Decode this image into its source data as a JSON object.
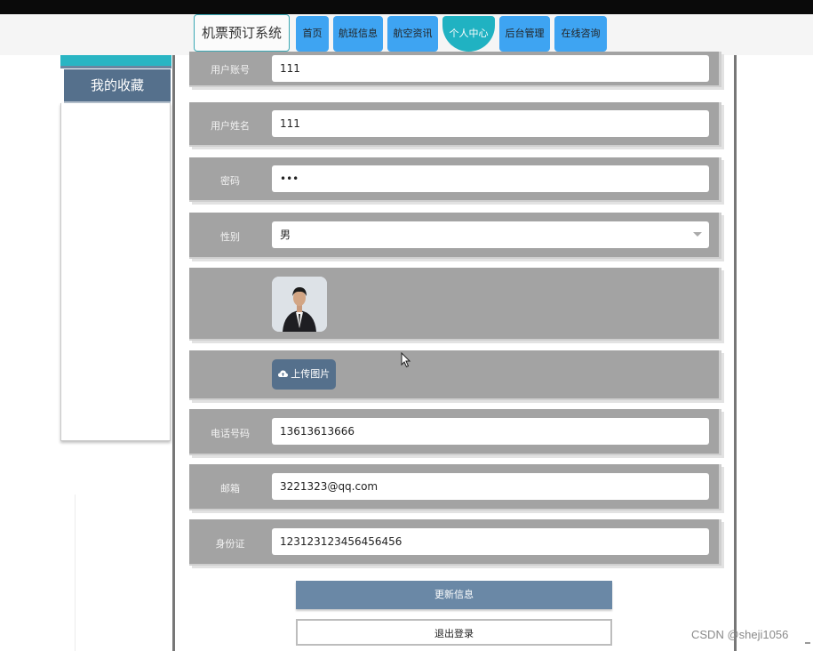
{
  "header": {
    "brand": "机票预订系统",
    "nav": [
      {
        "label": "首页",
        "active": false
      },
      {
        "label": "航班信息",
        "active": false
      },
      {
        "label": "航空资讯",
        "active": false
      },
      {
        "label": "个人中心",
        "active": true
      },
      {
        "label": "后台管理",
        "active": false
      },
      {
        "label": "在线咨询",
        "active": false
      }
    ]
  },
  "sidebar": {
    "items": [
      {
        "label": "我的收藏"
      }
    ]
  },
  "form": {
    "account": {
      "label": "用户账号",
      "value": "111"
    },
    "name": {
      "label": "用户姓名",
      "value": "111"
    },
    "password": {
      "label": "密码",
      "value": "•••"
    },
    "gender": {
      "label": "性别",
      "value": "男"
    },
    "avatar": {
      "label": ""
    },
    "upload": {
      "label": "上传图片",
      "icon": "cloud-upload-icon"
    },
    "phone": {
      "label": "电话号码",
      "value": "13613613666"
    },
    "email": {
      "label": "邮箱",
      "value": "3221323@qq.com"
    },
    "idcard": {
      "label": "身份证",
      "value": "123123123456456456"
    }
  },
  "actions": {
    "update": "更新信息",
    "logout": "退出登录"
  },
  "watermark": "CSDN @sheji1056",
  "colors": {
    "nav_button": "#3ea4f2",
    "nav_active": "#20b2c2",
    "sidebar_item": "#55708c",
    "row_bg": "#a3a3a3",
    "update_button": "#6a88a6"
  }
}
